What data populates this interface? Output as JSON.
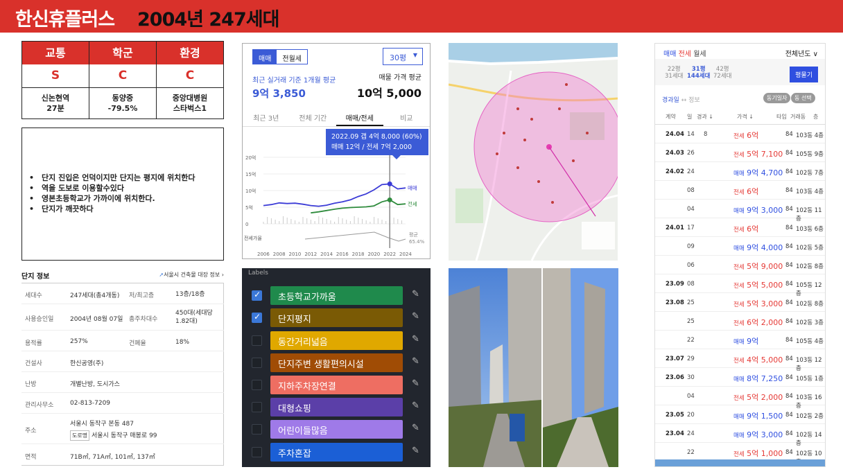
{
  "header": {
    "title": "한신휴플러스",
    "subtitle": "2004년 247세대"
  },
  "score": {
    "headers": [
      "교통",
      "학군",
      "환경"
    ],
    "grades": [
      "S",
      "C",
      "C"
    ],
    "details": [
      "신논현역\n27분",
      "동양중\n-79.5%",
      "중앙대병원\n스타벅스1"
    ]
  },
  "notes": [
    "단지 진입은 언덕이지만 단지는 평지에 위치한다",
    "역을 도보로 이용할수있다",
    "영본초등학교가 가까이에 위치한다.",
    "단지가 깨끗하다"
  ],
  "info": {
    "title": "단지 정보",
    "link": "서울시 건축물 대장 정보",
    "rows": [
      {
        "k": "세대수",
        "v": "247세대(총4개동)",
        "k2": "저/최고층",
        "v2": "13층/18층"
      },
      {
        "k": "사용승인일",
        "v": "2004년 08월 07일",
        "k2": "총주차대수",
        "v2": "450대(세대당 1.82대)"
      },
      {
        "k": "용적률",
        "v": "257%",
        "k2": "건폐율",
        "v2": "18%"
      },
      {
        "k": "건설사",
        "v": "한신공영(주)",
        "k2": "",
        "v2": ""
      },
      {
        "k": "난방",
        "v": "개별난방, 도시가스",
        "k2": "",
        "v2": ""
      },
      {
        "k": "관리사무소",
        "v": "02-813-7209",
        "k2": "",
        "v2": ""
      },
      {
        "k": "주소",
        "v": "서울시 동작구 본동 487",
        "k2": "",
        "v2": ""
      },
      {
        "k": "면적",
        "v": "71B㎡, 71A㎡, 101㎡, 137㎡",
        "k2": "",
        "v2": ""
      }
    ],
    "road_tag": "도로명",
    "road_addr": "서울시 동작구 매봉로 99"
  },
  "price": {
    "tabs": [
      "매매",
      "전월세"
    ],
    "pyeong": "30평",
    "label1": "최근 실거래 기준 1개월 평균",
    "value1": "9억 3,850",
    "label2": "매물 가격 평균",
    "value2": "10억 5,000",
    "ptabs": [
      "최근 3년",
      "전체 기간",
      "매매/전세",
      "비교"
    ],
    "tip_line1": "2022.09  갭 4억 8,000 (60%)",
    "tip_line2": "매매 12억 / 전세 7억 2,000",
    "ylabels": [
      "20억",
      "15억",
      "10억",
      "5억",
      "0"
    ],
    "xlabels": [
      "2006",
      "2008",
      "2010",
      "2012",
      "2014",
      "2016",
      "2018",
      "2020",
      "2022",
      "2024"
    ],
    "series_sale": "매매",
    "series_rent": "전세",
    "ratio_label": "전세가율",
    "ratio_value": "평균",
    "ratio_pct": "65.4%"
  },
  "chart_data": {
    "type": "line",
    "x": [
      2006,
      2007,
      2008,
      2009,
      2010,
      2011,
      2012,
      2013,
      2014,
      2015,
      2016,
      2017,
      2018,
      2019,
      2020,
      2021,
      2022,
      2023,
      2024
    ],
    "series": [
      {
        "name": "매매",
        "values": [
          5.5,
          5.8,
          6.3,
          6.1,
          6.2,
          5.9,
          5.5,
          5.3,
          5.6,
          6.2,
          6.6,
          7.2,
          8.2,
          9.0,
          10.2,
          11.8,
          12.0,
          10.5,
          10.8
        ]
      },
      {
        "name": "전세",
        "values": [
          null,
          null,
          null,
          null,
          null,
          null,
          3.3,
          3.6,
          4.0,
          4.4,
          4.7,
          4.9,
          5.0,
          5.1,
          5.4,
          6.6,
          7.2,
          5.8,
          6.0
        ]
      }
    ],
    "ylim": [
      0,
      20
    ],
    "xlabel": "",
    "ylabel": ""
  },
  "labels": {
    "title": "Labels",
    "items": [
      {
        "text": "초등학교가까움",
        "color": "#1f8a4c",
        "checked": true
      },
      {
        "text": "단지평지",
        "color": "#7a5a05",
        "checked": true
      },
      {
        "text": "동간거리넓음",
        "color": "#e0a800",
        "checked": false
      },
      {
        "text": "단지주변 생활편의시설",
        "color": "#a04c05",
        "checked": false
      },
      {
        "text": "지하주차장연결",
        "color": "#ee6e62",
        "checked": false
      },
      {
        "text": "대형쇼핑",
        "color": "#5b3fa8",
        "checked": false
      },
      {
        "text": "어린이들많음",
        "color": "#9f7ae8",
        "checked": false
      },
      {
        "text": "주차혼잡",
        "color": "#1b5fd6",
        "checked": false
      }
    ]
  },
  "tx": {
    "tabs": [
      "매매",
      "전세",
      "월세"
    ],
    "year": "전체년도 ∨",
    "sizes": [
      {
        "a": "22평",
        "b": "31세대"
      },
      {
        "a": "31평",
        "b": "144세대"
      },
      {
        "a": "42평",
        "b": "72세대"
      }
    ],
    "btn": "평물기",
    "sort": "경과일",
    "sort2": "↔ 정보",
    "chips": [
      "동기일자",
      "동 선택"
    ],
    "th": [
      "계약",
      "일",
      "경과 ↓",
      "가격 ↓",
      "타입",
      "거래동",
      "층"
    ],
    "rows": [
      {
        "ym": "24.04",
        "d": "14",
        "c": "8",
        "t": "전세",
        "p": "6억",
        "a": "84",
        "dg": "103동",
        "f": "4층"
      },
      {
        "ym": "24.03",
        "d": "26",
        "c": "",
        "t": "전세",
        "p": "5억 7,100",
        "a": "84",
        "dg": "105동",
        "f": "9층"
      },
      {
        "ym": "24.02",
        "d": "24",
        "c": "",
        "t": "매매",
        "p": "9억 4,700",
        "a": "84",
        "dg": "102동",
        "f": "7층"
      },
      {
        "ym": "",
        "d": "08",
        "c": "",
        "t": "전세",
        "p": "6억",
        "a": "84",
        "dg": "103동",
        "f": "4층"
      },
      {
        "ym": "",
        "d": "04",
        "c": "",
        "t": "매매",
        "p": "9억 3,000",
        "a": "84",
        "dg": "102동",
        "f": "11층"
      },
      {
        "ym": "24.01",
        "d": "17",
        "c": "",
        "t": "전세",
        "p": "6억",
        "a": "84",
        "dg": "103동",
        "f": "6층"
      },
      {
        "ym": "",
        "d": "09",
        "c": "",
        "t": "매매",
        "p": "9억 4,000",
        "a": "84",
        "dg": "102동",
        "f": "5층"
      },
      {
        "ym": "",
        "d": "06",
        "c": "",
        "t": "전세",
        "p": "5억 9,000",
        "a": "84",
        "dg": "102동",
        "f": "8층"
      },
      {
        "ym": "23.09",
        "d": "08",
        "c": "",
        "t": "전세",
        "p": "5억 5,000",
        "a": "84",
        "dg": "105동",
        "f": "12층"
      },
      {
        "ym": "23.08",
        "d": "25",
        "c": "",
        "t": "전세",
        "p": "5억 3,000",
        "a": "84",
        "dg": "102동",
        "f": "8층"
      },
      {
        "ym": "",
        "d": "25",
        "c": "",
        "t": "전세",
        "p": "6억 2,000",
        "a": "84",
        "dg": "102동",
        "f": "3층"
      },
      {
        "ym": "",
        "d": "22",
        "c": "",
        "t": "매매",
        "p": "9억",
        "a": "84",
        "dg": "105동",
        "f": "4층"
      },
      {
        "ym": "23.07",
        "d": "29",
        "c": "",
        "t": "전세",
        "p": "4억 5,000",
        "a": "84",
        "dg": "103동",
        "f": "12층"
      },
      {
        "ym": "23.06",
        "d": "30",
        "c": "",
        "t": "매매",
        "p": "8억 7,250",
        "a": "84",
        "dg": "105동",
        "f": "1층"
      },
      {
        "ym": "",
        "d": "04",
        "c": "",
        "t": "전세",
        "p": "5억 2,000",
        "a": "84",
        "dg": "103동",
        "f": "16층"
      },
      {
        "ym": "23.05",
        "d": "20",
        "c": "",
        "t": "매매",
        "p": "9억 1,500",
        "a": "84",
        "dg": "102동",
        "f": "2층"
      },
      {
        "ym": "23.04",
        "d": "24",
        "c": "",
        "t": "매매",
        "p": "9억 3,000",
        "a": "84",
        "dg": "102동",
        "f": "14층"
      },
      {
        "ym": "",
        "d": "22",
        "c": "",
        "t": "전세",
        "p": "5억 1,000",
        "a": "84",
        "dg": "102동",
        "f": "10층"
      }
    ]
  }
}
